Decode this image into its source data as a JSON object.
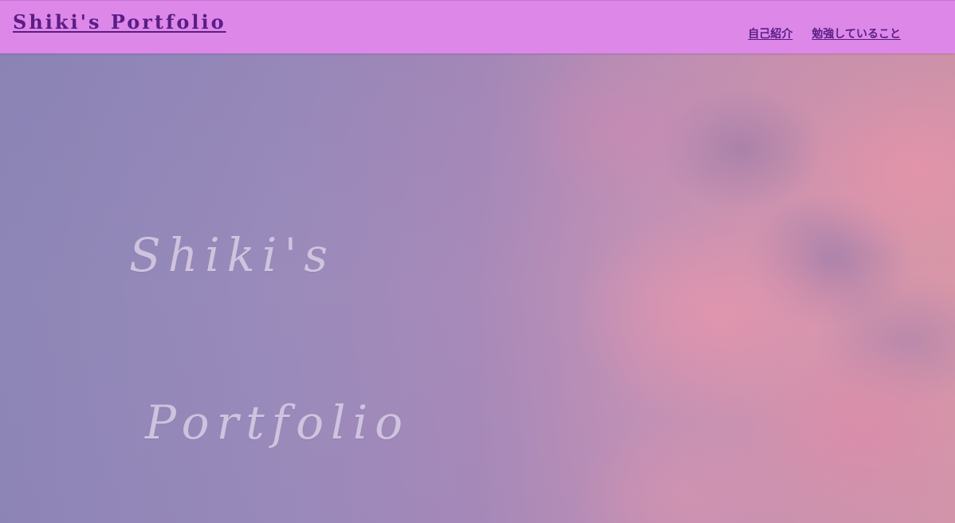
{
  "header": {
    "title": "Shiki's Portfolio",
    "nav": [
      {
        "label": "自己紹介"
      },
      {
        "label": "勉強していること"
      }
    ]
  },
  "hero": {
    "line1": "Shiki's",
    "line2": "Portfolio"
  },
  "colors": {
    "header_bg": "#dd88e8",
    "link": "#5a1d86",
    "hero_text": "#d7cbe4"
  }
}
